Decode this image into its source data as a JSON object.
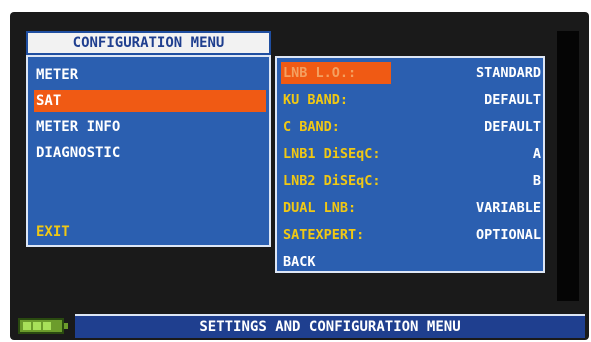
{
  "menu": {
    "title": "CONFIGURATION MENU",
    "items": [
      {
        "label": "METER"
      },
      {
        "label": "SAT"
      },
      {
        "label": "METER INFO"
      },
      {
        "label": "DIAGNOSTIC"
      },
      {
        "label": "EXIT"
      }
    ],
    "selected": "SAT"
  },
  "sat_settings": {
    "rows": [
      {
        "label": "LNB L.O.:",
        "value": "STANDARD"
      },
      {
        "label": "KU BAND:",
        "value": "DEFAULT"
      },
      {
        "label": "C BAND:",
        "value": "DEFAULT"
      },
      {
        "label": "LNB1 DiSEqC:",
        "value": "A"
      },
      {
        "label": "LNB2 DiSEqC:",
        "value": "B"
      },
      {
        "label": "DUAL LNB:",
        "value": "VARIABLE"
      },
      {
        "label": "SATEXPERT:",
        "value": "OPTIONAL"
      },
      {
        "label": "BACK",
        "value": ""
      }
    ],
    "selected": "LNB L.O.:"
  },
  "status_bar": {
    "text": "SETTINGS AND CONFIGURATION MENU"
  },
  "colors": {
    "panel_blue": "#2b5fb0",
    "highlight_orange": "#f05a14",
    "label_yellow": "#f0c814",
    "battery_green": "#6c9c2c"
  }
}
